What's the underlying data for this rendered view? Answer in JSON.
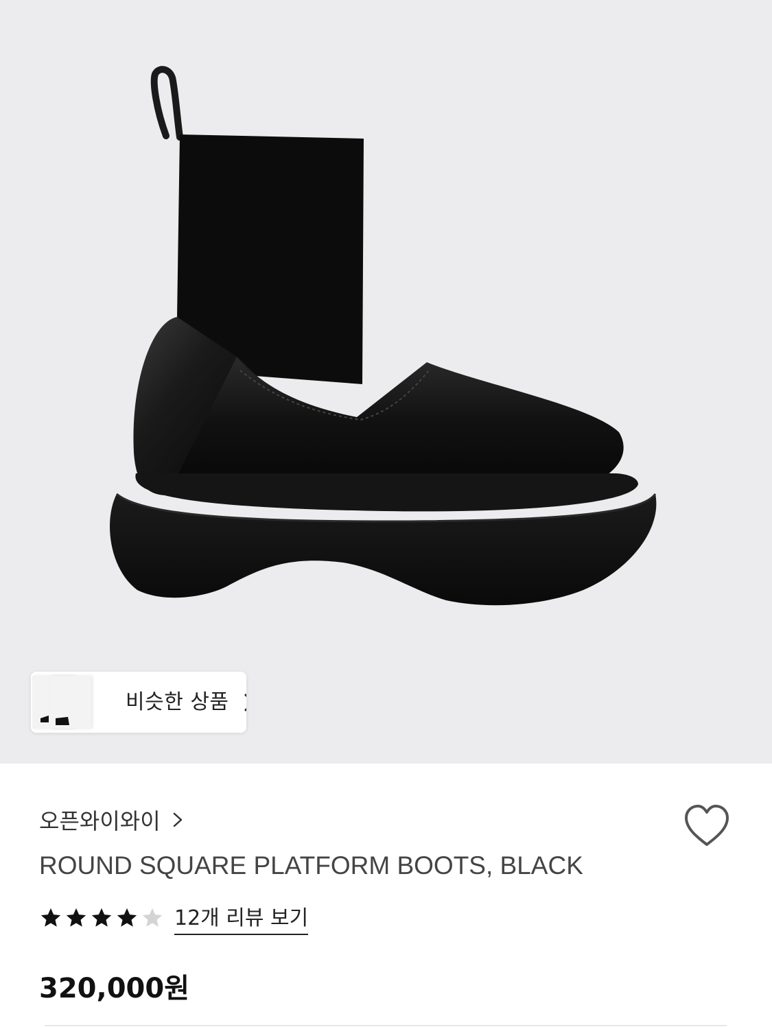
{
  "product_image": {
    "alt": "",
    "background_color": "#ececee"
  },
  "similar_products": {
    "label": "비슷한 상품",
    "icon": "chevron-right-icon"
  },
  "brand": {
    "name": "오픈와이와이",
    "icon": "chevron-right-icon"
  },
  "wishlist": {
    "icon": "heart-outline-icon"
  },
  "product": {
    "title": "ROUND SQUARE PLATFORM BOOTS, BLACK",
    "price": "320,000원"
  },
  "rating": {
    "stars_filled": 4,
    "stars_total": 5,
    "review_link": "12개 리뷰 보기"
  },
  "colors": {
    "star_filled": "#111111",
    "star_empty": "#d4d4d4",
    "heart_stroke": "#555555"
  }
}
